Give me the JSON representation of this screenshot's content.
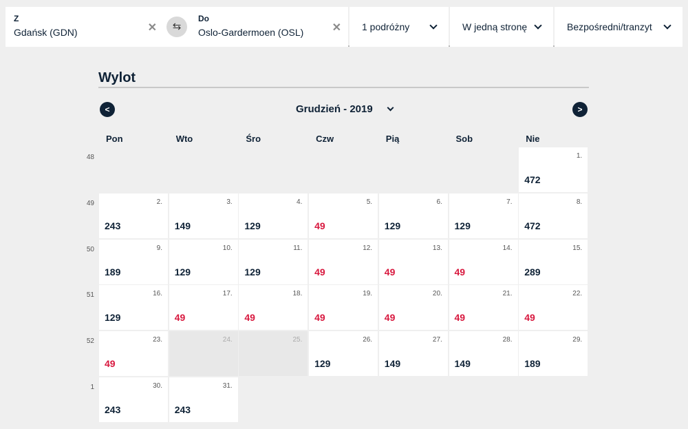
{
  "search": {
    "from": {
      "label": "Z",
      "value": "Gdańsk (GDN)"
    },
    "to": {
      "label": "Do",
      "value": "Oslo-Gardermoen (OSL)"
    },
    "travelers": "1 podróżny",
    "trip_type": "W jedną stronę",
    "stops": "Bezpośredni/tranzyt"
  },
  "calendar": {
    "title": "Wylot",
    "month": "Grudzień - 2019",
    "weekdays": [
      "Pon",
      "Wto",
      "Śro",
      "Czw",
      "Pią",
      "Sob",
      "Nie"
    ],
    "weeks": [
      {
        "number": "48",
        "days": [
          {
            "empty": true
          },
          {
            "empty": true
          },
          {
            "empty": true
          },
          {
            "empty": true
          },
          {
            "empty": true
          },
          {
            "empty": true
          },
          {
            "day": "1.",
            "price": "472"
          }
        ]
      },
      {
        "number": "49",
        "days": [
          {
            "day": "2.",
            "price": "243"
          },
          {
            "day": "3.",
            "price": "149"
          },
          {
            "day": "4.",
            "price": "129"
          },
          {
            "day": "5.",
            "price": "49",
            "lowest": true
          },
          {
            "day": "6.",
            "price": "129"
          },
          {
            "day": "7.",
            "price": "129"
          },
          {
            "day": "8.",
            "price": "472"
          }
        ]
      },
      {
        "number": "50",
        "days": [
          {
            "day": "9.",
            "price": "189"
          },
          {
            "day": "10.",
            "price": "129"
          },
          {
            "day": "11.",
            "price": "129"
          },
          {
            "day": "12.",
            "price": "49",
            "lowest": true
          },
          {
            "day": "13.",
            "price": "49",
            "lowest": true
          },
          {
            "day": "14.",
            "price": "49",
            "lowest": true
          },
          {
            "day": "15.",
            "price": "289"
          }
        ]
      },
      {
        "number": "51",
        "days": [
          {
            "day": "16.",
            "price": "129"
          },
          {
            "day": "17.",
            "price": "49",
            "lowest": true
          },
          {
            "day": "18.",
            "price": "49",
            "lowest": true
          },
          {
            "day": "19.",
            "price": "49",
            "lowest": true
          },
          {
            "day": "20.",
            "price": "49",
            "lowest": true
          },
          {
            "day": "21.",
            "price": "49",
            "lowest": true
          },
          {
            "day": "22.",
            "price": "49",
            "lowest": true
          }
        ]
      },
      {
        "number": "52",
        "days": [
          {
            "day": "23.",
            "price": "49",
            "lowest": true
          },
          {
            "day": "24.",
            "disabled": true
          },
          {
            "day": "25.",
            "disabled": true
          },
          {
            "day": "26.",
            "price": "129"
          },
          {
            "day": "27.",
            "price": "149"
          },
          {
            "day": "28.",
            "price": "149"
          },
          {
            "day": "29.",
            "price": "189"
          }
        ]
      },
      {
        "number": "1",
        "days": [
          {
            "day": "30.",
            "price": "243"
          },
          {
            "day": "31.",
            "price": "243"
          }
        ]
      }
    ]
  },
  "colors": {
    "text": "#0f2236",
    "lowest_price": "#d8183e",
    "disabled_cell": "#e8e8e8",
    "background": "#efefef"
  }
}
